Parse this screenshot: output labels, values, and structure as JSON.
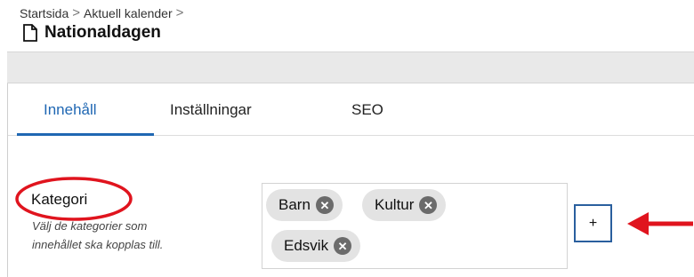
{
  "breadcrumb": {
    "items": [
      "Startsida",
      "Aktuell kalender"
    ],
    "separator": ">"
  },
  "page": {
    "title": "Nationaldagen",
    "icon": "document-icon"
  },
  "tabs": [
    {
      "label": "Innehåll",
      "active": true
    },
    {
      "label": "Inställningar",
      "active": false
    },
    {
      "label": "SEO",
      "active": false
    }
  ],
  "field": {
    "label": "Kategori",
    "help_line1": "Välj de kategorier som",
    "help_line2": "innehållet ska kopplas till."
  },
  "tags": [
    {
      "label": "Barn",
      "remove_icon": "close-circle-icon"
    },
    {
      "label": "Kultur",
      "remove_icon": "close-circle-icon"
    },
    {
      "label": "Edsvik",
      "remove_icon": "close-circle-icon"
    }
  ],
  "add_button": {
    "label": "+"
  },
  "colors": {
    "accent": "#1f67b3",
    "annotation": "#e0141e",
    "tag_bg": "#e3e3e3",
    "button_border": "#2a5f9e"
  }
}
